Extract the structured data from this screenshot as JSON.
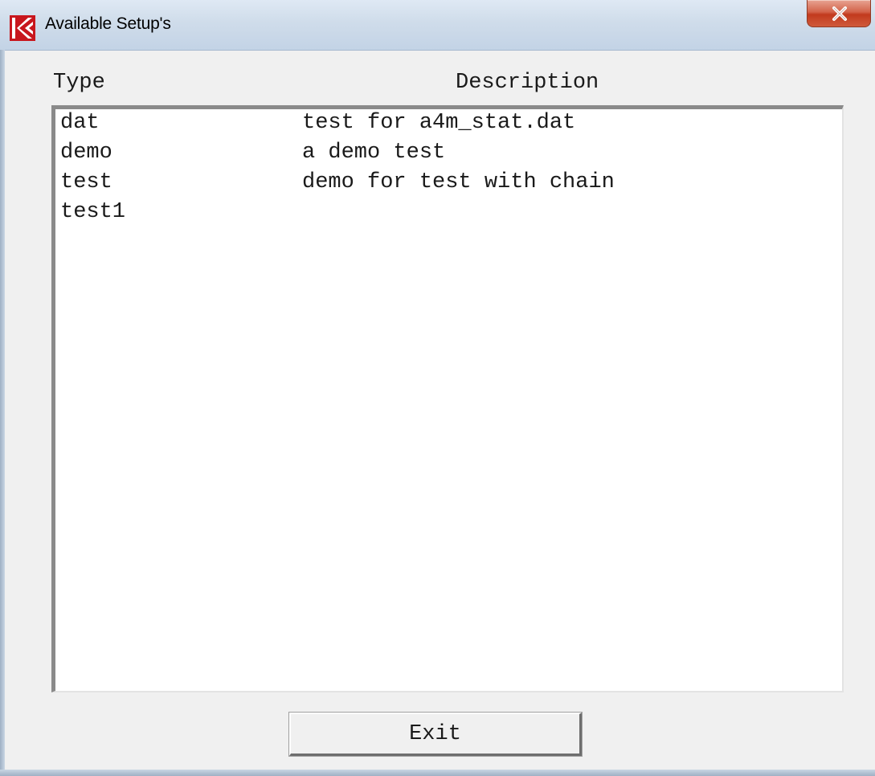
{
  "window": {
    "title": "Available Setup's",
    "app_icon": "red-k-logo-icon",
    "close_icon": "close-x-icon",
    "colors": {
      "titlebar": "#cfdcea",
      "close_button": "#c9452a",
      "background": "#f0f0f0",
      "list_background": "#ffffff"
    }
  },
  "list": {
    "headers": {
      "type": "Type",
      "description": "Description"
    },
    "rows": [
      {
        "type": "dat",
        "description": "test for a4m_stat.dat"
      },
      {
        "type": "demo",
        "description": "a demo test"
      },
      {
        "type": "test",
        "description": "demo for test with chain"
      },
      {
        "type": "test1",
        "description": ""
      }
    ]
  },
  "buttons": {
    "exit_label": "Exit"
  }
}
